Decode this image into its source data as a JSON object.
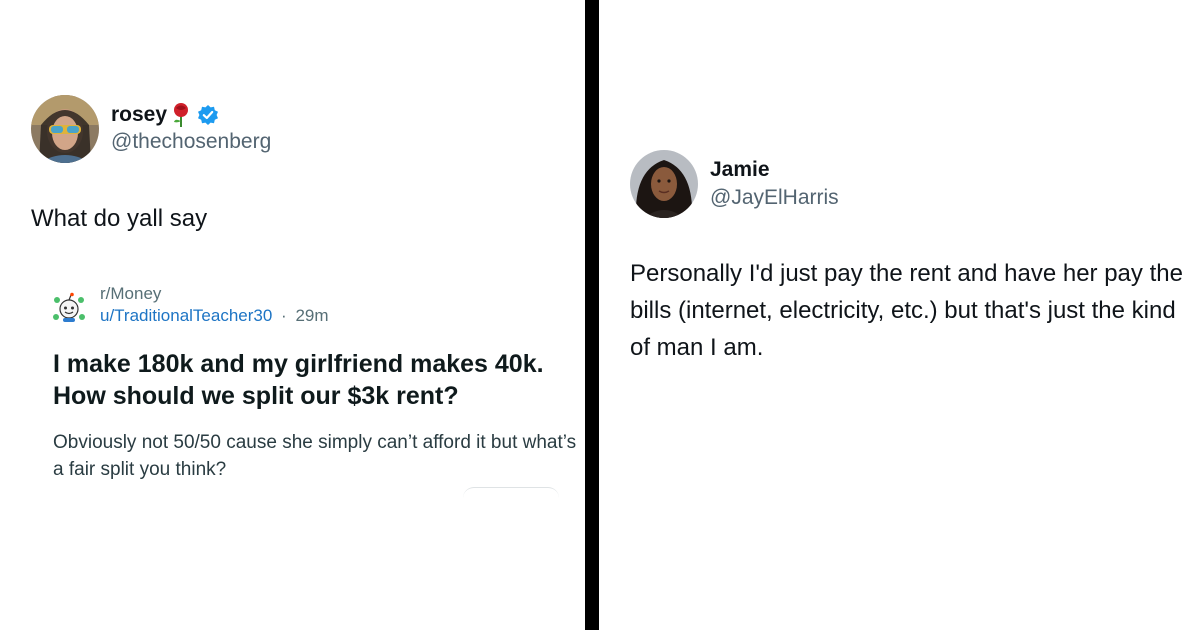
{
  "left_tweet": {
    "display_name": "rosey",
    "handle": "@thechosenberg",
    "text": "What do yall say",
    "name_emoji": "rose-icon",
    "verified": true,
    "embed": {
      "subreddit": "r/Money",
      "username": "u/TraditionalTeacher30",
      "separator": "·",
      "time": "29m",
      "title": "I make 180k and my girlfriend makes 40k. How should we split our $3k rent?",
      "body": "Obviously not 50/50 cause she simply can’t afford it but what’s a fair split you think?"
    }
  },
  "right_tweet": {
    "display_name": "Jamie",
    "handle": "@JayElHarris",
    "text": "Personally I'd just pay the rent and have her pay the bills (internet, electricity, etc.) but that's just the kind of man I am."
  },
  "colors": {
    "divider": "#000000",
    "verified": "#1d9bf0",
    "link": "#1d74c4",
    "muted": "#536471"
  }
}
